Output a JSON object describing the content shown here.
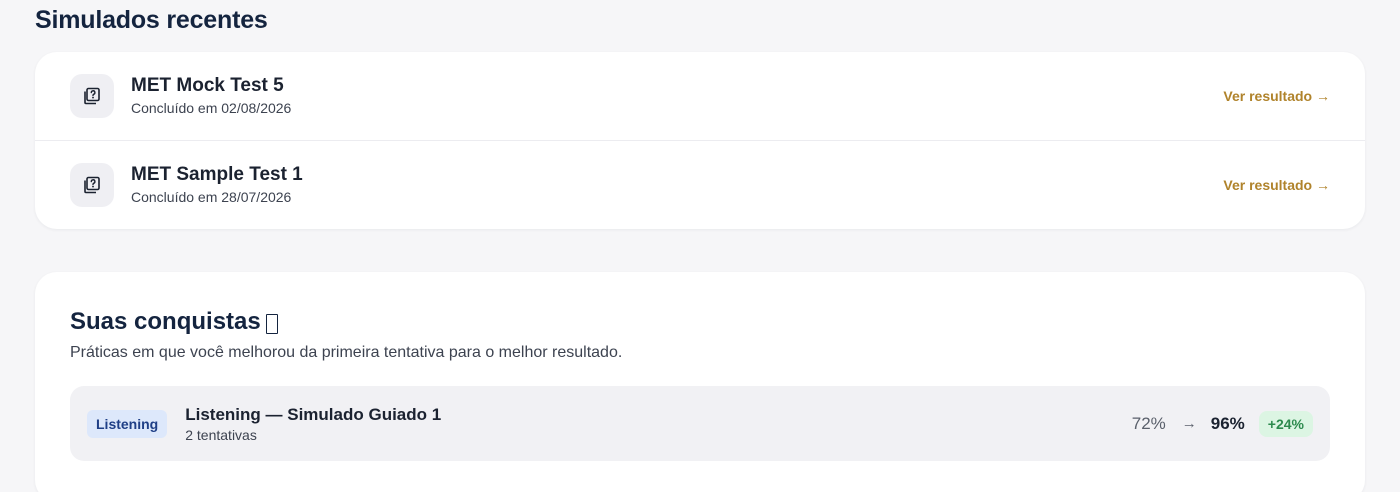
{
  "recent": {
    "title": "Simulados recentes",
    "items": [
      {
        "name": "MET Mock Test 5",
        "completed": "Concluído em 02/08/2026",
        "link_label": "Ver resultado →",
        "icon": "quiz-icon"
      },
      {
        "name": "MET Sample Test 1",
        "completed": "Concluído em 28/07/2026",
        "link_label": "Ver resultado →",
        "icon": "quiz-icon"
      }
    ]
  },
  "achievements": {
    "title": "Suas conquistas",
    "subtitle": "Práticas em que você melhorou da primeira tentativa para o melhor resultado.",
    "items": [
      {
        "skill": "Listening",
        "name": "Listening — Simulado Guiado 1",
        "attempts": "2 tentativas",
        "first_score": "72%",
        "arrow": "→",
        "best_score": "96%",
        "delta": "+24%"
      }
    ]
  },
  "colors": {
    "accent_link": "#b0832b",
    "heading": "#14243f",
    "badge_blue_bg": "#dde8fb",
    "badge_green_bg": "#dcf5e3"
  }
}
